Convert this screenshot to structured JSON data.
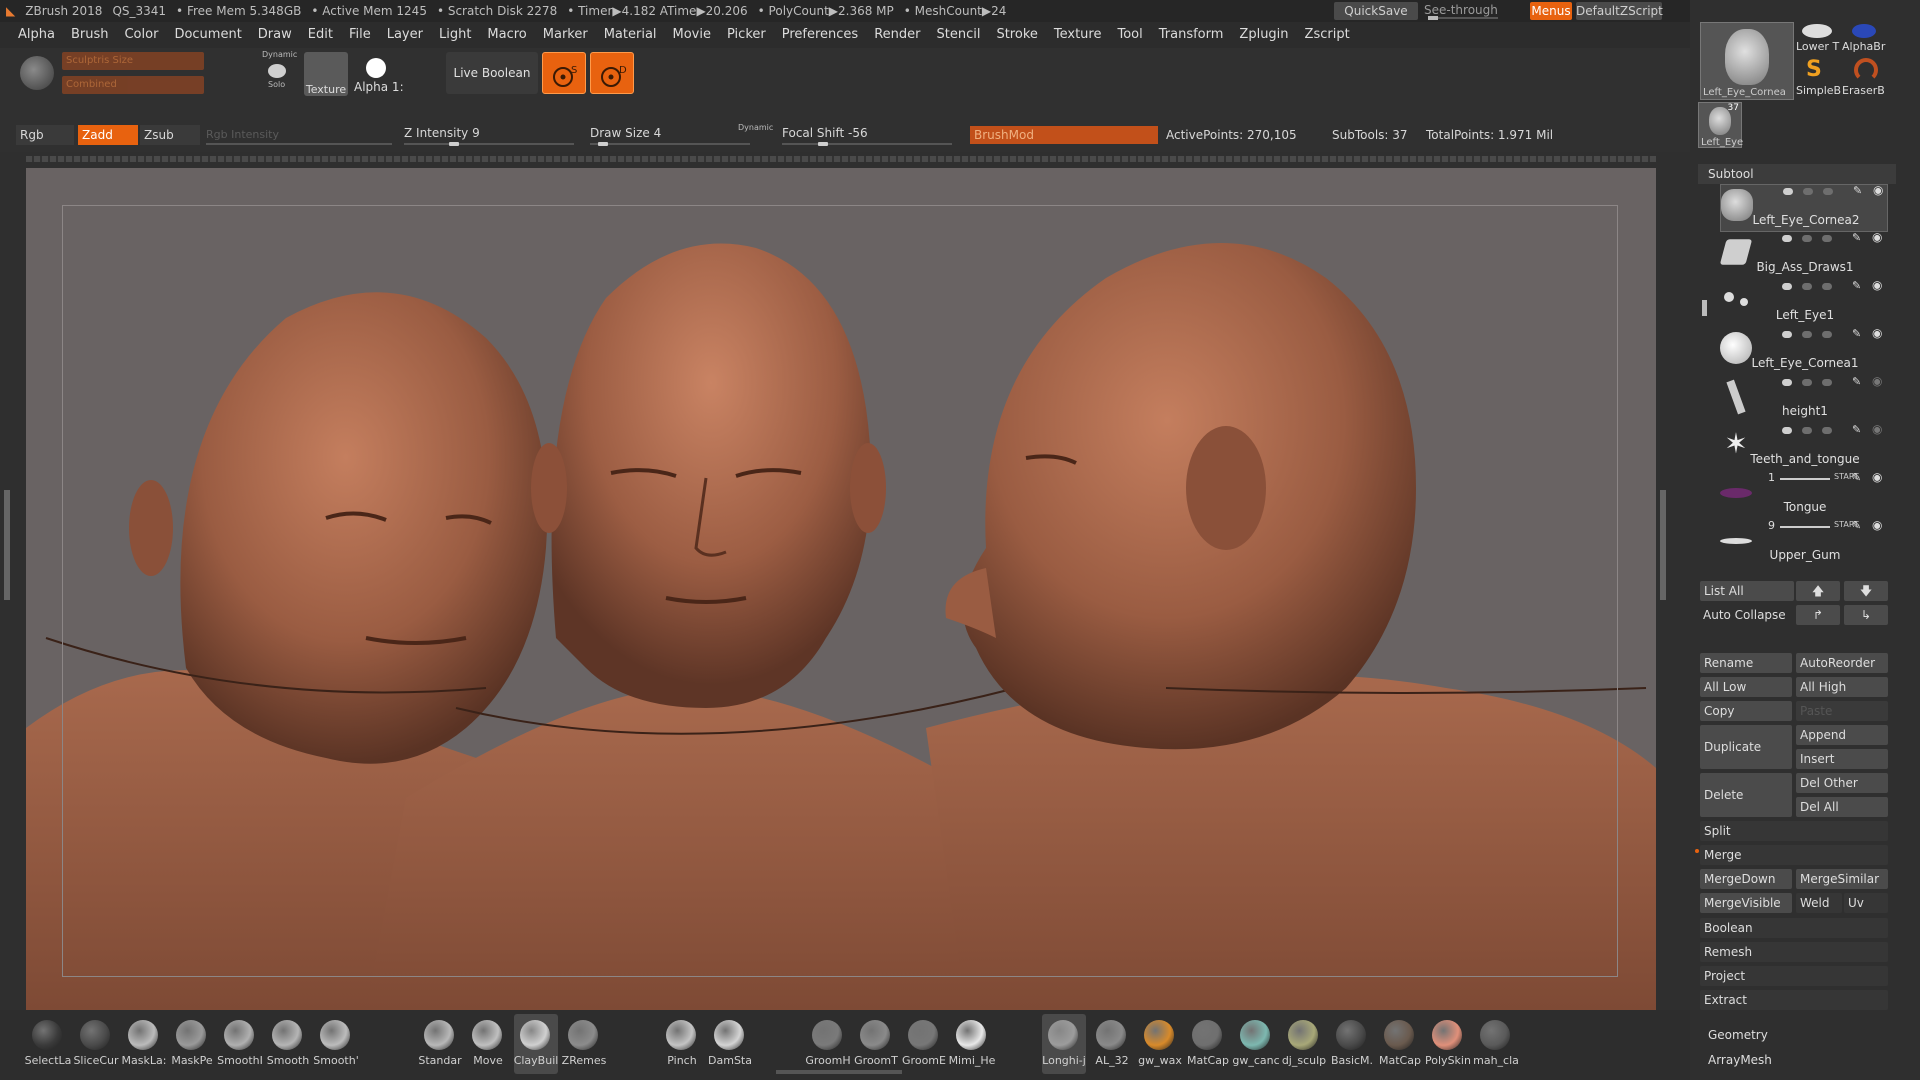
{
  "titlebar": {
    "app": "ZBrush 2018",
    "doc": "QS_3341",
    "free_mem": "• Free Mem 5.348GB",
    "active_mem": "• Active Mem 1245",
    "scratch": "• Scratch Disk 2278",
    "timer": "• Timer▶4.182 ATime▶20.206",
    "polycount": "• PolyCount▶2.368 MP",
    "meshcount": "• MeshCount▶24",
    "quicksave": "QuickSave",
    "see_through": "See-through",
    "see_through_value": "0",
    "menus": "Menus",
    "default_zscript": "DefaultZScript"
  },
  "menu": [
    "Alpha",
    "Brush",
    "Color",
    "Document",
    "Draw",
    "Edit",
    "File",
    "Layer",
    "Light",
    "Macro",
    "Marker",
    "Material",
    "Movie",
    "Picker",
    "Preferences",
    "Render",
    "Stencil",
    "Stroke",
    "Texture",
    "Tool",
    "Transform",
    "Zplugin",
    "Zscript"
  ],
  "shelf": {
    "sculptris_size": "Sculptris Size",
    "combined": "Combined",
    "dynamic": "Dynamic",
    "solo": "Solo",
    "texture": "Texture",
    "alpha": "Alpha 1:",
    "live_boolean": "Live Boolean",
    "btn_s": "S",
    "btn_d": "D"
  },
  "params": {
    "rgb": "Rgb",
    "zadd": "Zadd",
    "zsub": "Zsub",
    "rgb_intensity": "Rgb Intensity",
    "z_intensity": "Z Intensity 9",
    "draw_size": "Draw Size 4",
    "dynamic": "Dynamic",
    "focal_shift": "Focal Shift -56",
    "brushmod": "BrushMod",
    "active_points": "ActivePoints: 270,105",
    "subtools": "SubTools: 37",
    "total_points": "TotalPoints: 1.971 Mil"
  },
  "tool_thumbs": [
    {
      "label": "Left_Eye_Cornea"
    },
    {
      "label": "Lower T"
    },
    {
      "label": "AlphaBr"
    },
    {
      "label": "SimpleB"
    },
    {
      "label": "EraserB"
    },
    {
      "label": "Left_Eye",
      "badge": "37"
    }
  ],
  "subtool": {
    "header": "Subtool",
    "items": [
      {
        "name": "Left_Eye_Cornea2",
        "extra": ""
      },
      {
        "name": "Big_Ass_Draws1",
        "extra": ""
      },
      {
        "name": "Left_Eye1",
        "extra": ""
      },
      {
        "name": "Left_Eye_Cornea1",
        "extra": ""
      },
      {
        "name": "height1",
        "extra": ""
      },
      {
        "name": "Teeth_and_tongue",
        "extra": ""
      },
      {
        "name": "Tongue",
        "extra": "1",
        "start": "START"
      },
      {
        "name": "Upper_Gum",
        "extra": "9",
        "start": "START"
      }
    ],
    "list_all": "List All",
    "auto_collapse": "Auto Collapse",
    "rename": "Rename",
    "autoreorder": "AutoReorder",
    "all_low": "All Low",
    "all_high": "All High",
    "copy": "Copy",
    "paste": "Paste",
    "duplicate": "Duplicate",
    "append": "Append",
    "insert": "Insert",
    "delete": "Delete",
    "del_other": "Del Other",
    "del_all": "Del All",
    "split": "Split",
    "merge": "Merge",
    "mergedown": "MergeDown",
    "mergesimilar": "MergeSimilar",
    "mergevisible": "MergeVisible",
    "weld": "Weld",
    "uv": "Uv",
    "boolean": "Boolean",
    "remesh": "Remesh",
    "project": "Project",
    "extract": "Extract",
    "geometry": "Geometry",
    "arraymesh": "ArrayMesh"
  },
  "bottom_shelf": [
    {
      "label": "SelectLa",
      "color": "#3a3a3a"
    },
    {
      "label": "SliceCur",
      "color": "#4a4a4a"
    },
    {
      "label": "MaskLa:",
      "color": "#bbbbbb"
    },
    {
      "label": "MaskPe",
      "color": "#9a9a9a"
    },
    {
      "label": "SmoothI",
      "color": "#b0b0b0"
    },
    {
      "label": "Smooth",
      "color": "#b5b5b5"
    },
    {
      "label": "Smooth'",
      "color": "#bcbcbc"
    },
    {
      "label": "Standar",
      "color": "#b8b8b8"
    },
    {
      "label": "Move",
      "color": "#c0c0c0"
    },
    {
      "label": "ClayBuil",
      "color": "#d0d0d0"
    },
    {
      "label": "ZRemes",
      "color": "#8c8c8c"
    },
    {
      "label": "Pinch",
      "color": "#c4c4c4"
    },
    {
      "label": "DamSta",
      "color": "#d4d4d4"
    },
    {
      "label": "GroomH",
      "color": "#7a7a7a"
    },
    {
      "label": "GroomT",
      "color": "#8a8a8a"
    },
    {
      "label": "GroomE",
      "color": "#777777"
    },
    {
      "label": "Mimi_He",
      "color": "#e8e8e8"
    },
    {
      "label": "Longhi-j",
      "color": "#9c9c9c"
    },
    {
      "label": "AL_32",
      "color": "#8a8a8a"
    },
    {
      "label": "gw_wax",
      "color": "#d88a2a"
    },
    {
      "label": "MatCap",
      "color": "#6f6f6f"
    },
    {
      "label": "gw_canc",
      "color": "#7db8b0"
    },
    {
      "label": "dj_sculp",
      "color": "#a8a878"
    },
    {
      "label": "BasicM.",
      "color": "#4a4a4a"
    },
    {
      "label": "MatCap",
      "color": "#6a5a4e"
    },
    {
      "label": "PolySkin",
      "color": "#e0907a"
    },
    {
      "label": "mah_cla",
      "color": "#5a5a5a"
    }
  ],
  "colors": {
    "accent": "#e8620f",
    "viewport_bg": "#696363",
    "skin": "#a4654a"
  }
}
